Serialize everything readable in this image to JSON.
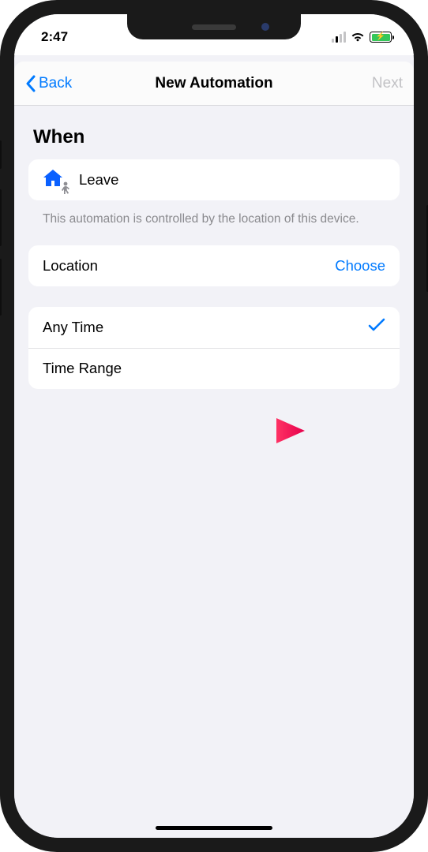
{
  "status": {
    "time": "2:47"
  },
  "nav": {
    "back_label": "Back",
    "title": "New Automation",
    "next_label": "Next"
  },
  "sections": {
    "when_heading": "When",
    "trigger_label": "Leave",
    "footnote": "This automation is controlled by the location of this device.",
    "location_label": "Location",
    "choose_label": "Choose",
    "time_options": [
      {
        "label": "Any Time",
        "selected": true
      },
      {
        "label": "Time Range",
        "selected": false
      }
    ]
  }
}
